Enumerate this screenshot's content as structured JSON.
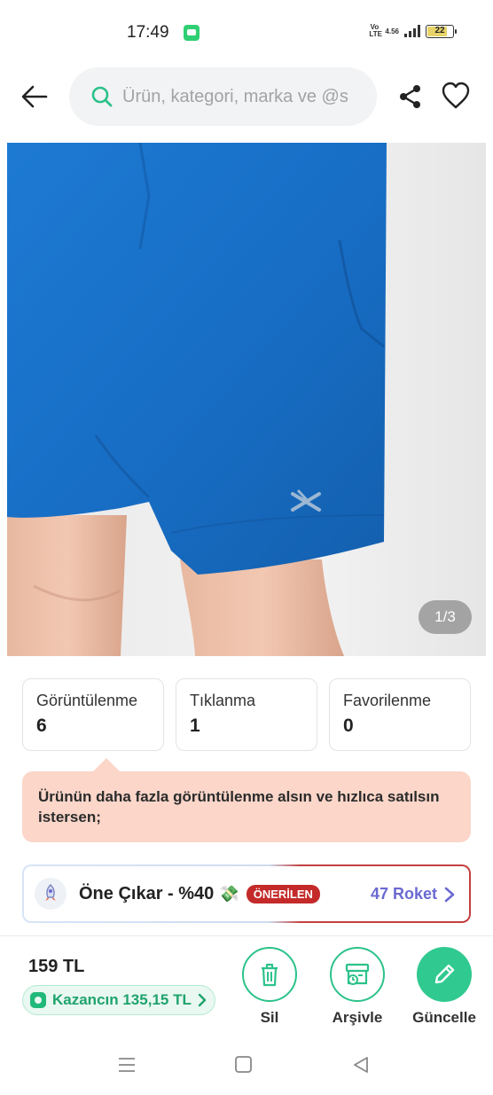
{
  "status_bar": {
    "time": "17:49",
    "network_lte": "Vo LTE",
    "network_speed": "4.56",
    "battery": "22",
    "icons": [
      "chat-notification-icon",
      "signal-icon",
      "battery-icon"
    ]
  },
  "header": {
    "search_placeholder": "Ürün, kategori, marka ve @s",
    "icons": [
      "back-arrow-icon",
      "search-icon",
      "share-icon",
      "heart-icon"
    ]
  },
  "product": {
    "brand_mark": "kinetix",
    "image_counter": "1/3",
    "colors": {
      "shorts": "#1a73c9"
    }
  },
  "stats": [
    {
      "label": "Görüntülenme",
      "value": "6"
    },
    {
      "label": "Tıklanma",
      "value": "1"
    },
    {
      "label": "Favorilenme",
      "value": "0"
    }
  ],
  "info_banner": {
    "text": "Ürünün daha fazla görüntülenme alsın ve hızlıca satılsın istersen;"
  },
  "promo": {
    "title": "Öne Çıkar - %40",
    "money_icon": "💸",
    "badge": "ÖNERİLEN",
    "roket": "47 Roket"
  },
  "bottom": {
    "price": "159 TL",
    "earning": "Kazancın 135,15 TL",
    "actions": [
      {
        "label": "Sil",
        "icon": "trash-icon"
      },
      {
        "label": "Arşivle",
        "icon": "archive-icon"
      },
      {
        "label": "Güncelle",
        "icon": "pencil-icon"
      }
    ]
  },
  "colors": {
    "accent_green": "#30c98f",
    "badge_red": "#c42a2a",
    "roket_purple": "#6b69d1",
    "banner_peach": "#fbd6c9"
  }
}
